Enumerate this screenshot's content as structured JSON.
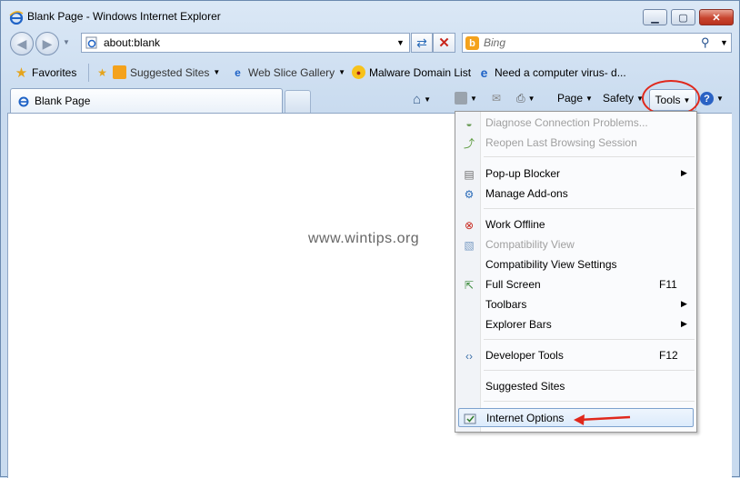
{
  "window": {
    "title": "Blank Page - Windows Internet Explorer"
  },
  "title_buttons": {
    "minimize": "▁",
    "maximize": "▢",
    "close": "✕"
  },
  "nav": {
    "back_icon": "back-arrow-icon",
    "forward_icon": "forward-arrow-icon",
    "address_value": "about:blank",
    "search_placeholder": "Bing",
    "search_engine_letter": "b"
  },
  "favorites_bar": {
    "favorites_label": "Favorites",
    "items": [
      {
        "label": "Suggested Sites",
        "icon": "suggested-sites-icon"
      },
      {
        "label": "Web Slice Gallery",
        "icon": "ie-page-icon"
      },
      {
        "label": "Malware Domain List",
        "icon": "malware-icon"
      },
      {
        "label": "Need a computer virus- d...",
        "icon": "ie-logo-icon"
      }
    ]
  },
  "tab": {
    "label": "Blank Page"
  },
  "command_bar": {
    "page_label": "Page",
    "safety_label": "Safety",
    "tools_label": "Tools",
    "help_letter": "?"
  },
  "watermark": "www.wintips.org",
  "tools_menu": {
    "items": [
      {
        "label": "Diagnose Connection Problems...",
        "disabled": true,
        "icon": "diagnose-icon"
      },
      {
        "label": "Reopen Last Browsing Session",
        "disabled": true,
        "icon": "reopen-icon"
      },
      {
        "label": "Pop-up Blocker",
        "submenu": true,
        "icon": "popup-blocker-icon"
      },
      {
        "label": "Manage Add-ons",
        "icon": "addons-icon"
      },
      {
        "label": "Work Offline",
        "icon": "work-offline-icon"
      },
      {
        "label": "Compatibility View",
        "disabled": true,
        "icon": "compat-view-icon"
      },
      {
        "label": "Compatibility View Settings"
      },
      {
        "label": "Full Screen",
        "shortcut": "F11",
        "icon": "fullscreen-icon"
      },
      {
        "label": "Toolbars",
        "submenu": true
      },
      {
        "label": "Explorer Bars",
        "submenu": true
      },
      {
        "label": "Developer Tools",
        "shortcut": "F12",
        "icon": "developer-tools-icon"
      },
      {
        "label": "Suggested Sites"
      },
      {
        "label": "Internet Options",
        "highlighted": true,
        "icon": "internet-options-icon"
      }
    ]
  },
  "colors": {
    "annotation_red": "#e0281c",
    "ie_blue": "#1f63c6"
  }
}
